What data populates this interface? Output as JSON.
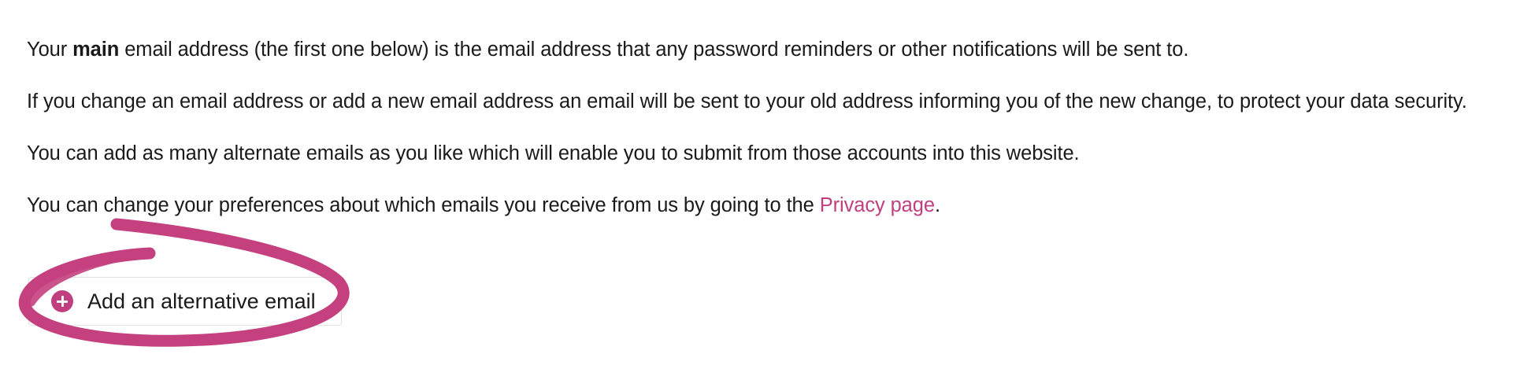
{
  "intro": {
    "p1_before": "Your ",
    "p1_bold": "main",
    "p1_after": " email address (the first one below) is the email address that any password reminders or other notifications will be sent to.",
    "p2": "If you change an email address or add a new email address an email will be sent to your old address informing you of the new change, to protect your data security.",
    "p3": "You can add as many alternate emails as you like which will enable you to submit from those accounts into this website.",
    "p4_before": "You can change your preferences about which emails you receive from us by going to the ",
    "p4_link": "Privacy page",
    "p4_after": "."
  },
  "add_email_button": {
    "label": "Add an alternative email",
    "icon": "plus-circle-icon"
  },
  "colors": {
    "accent": "#c0407f",
    "text": "#1a1a1a",
    "annotation": "#c4407f"
  }
}
